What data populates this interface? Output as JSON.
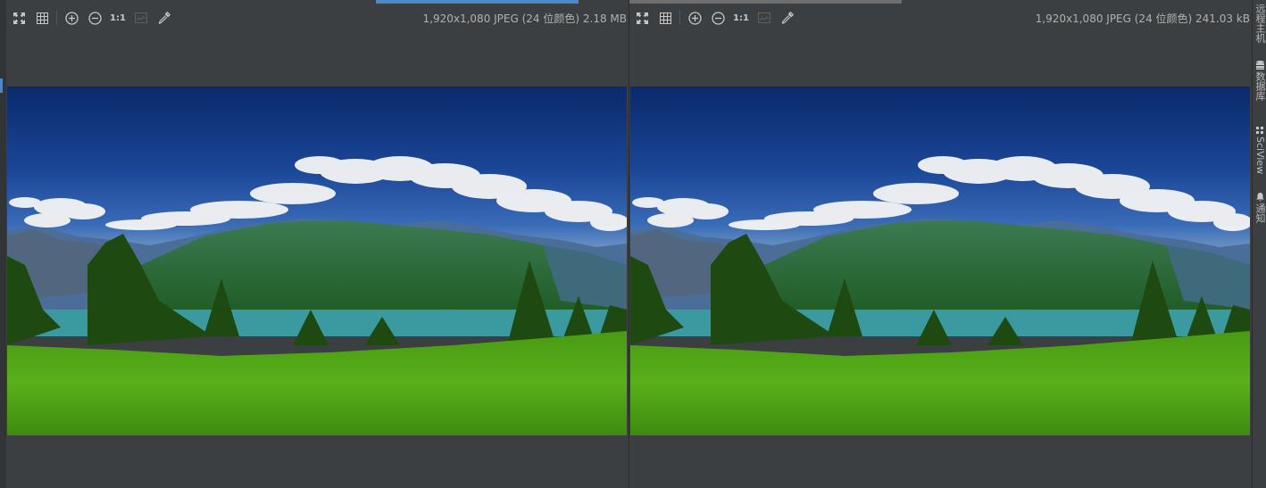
{
  "panes": [
    {
      "info": "1,920x1,080 JPEG (24 位颜色) 2.18 MB"
    },
    {
      "info": "1,920x1,080 JPEG (24 位颜色) 241.03 kB"
    }
  ],
  "toolbar": {
    "actual_size_label": "1:1",
    "buttons": [
      "fit-to-window-icon",
      "grid-icon",
      "zoom-in-icon",
      "zoom-out-icon",
      "actual-size",
      "background-icon",
      "color-picker-icon"
    ]
  },
  "right_sidebar": {
    "items": [
      {
        "label": "远程主机",
        "icon": "server-icon"
      },
      {
        "label": "数据库",
        "icon": "database-icon"
      },
      {
        "label": "SciView",
        "icon": "sciview-icon"
      },
      {
        "label": "通知",
        "icon": "bell-icon"
      }
    ]
  },
  "colors": {
    "background": "#3c3f41",
    "accent": "#4a88c7",
    "icon": "#c8c8c8"
  }
}
